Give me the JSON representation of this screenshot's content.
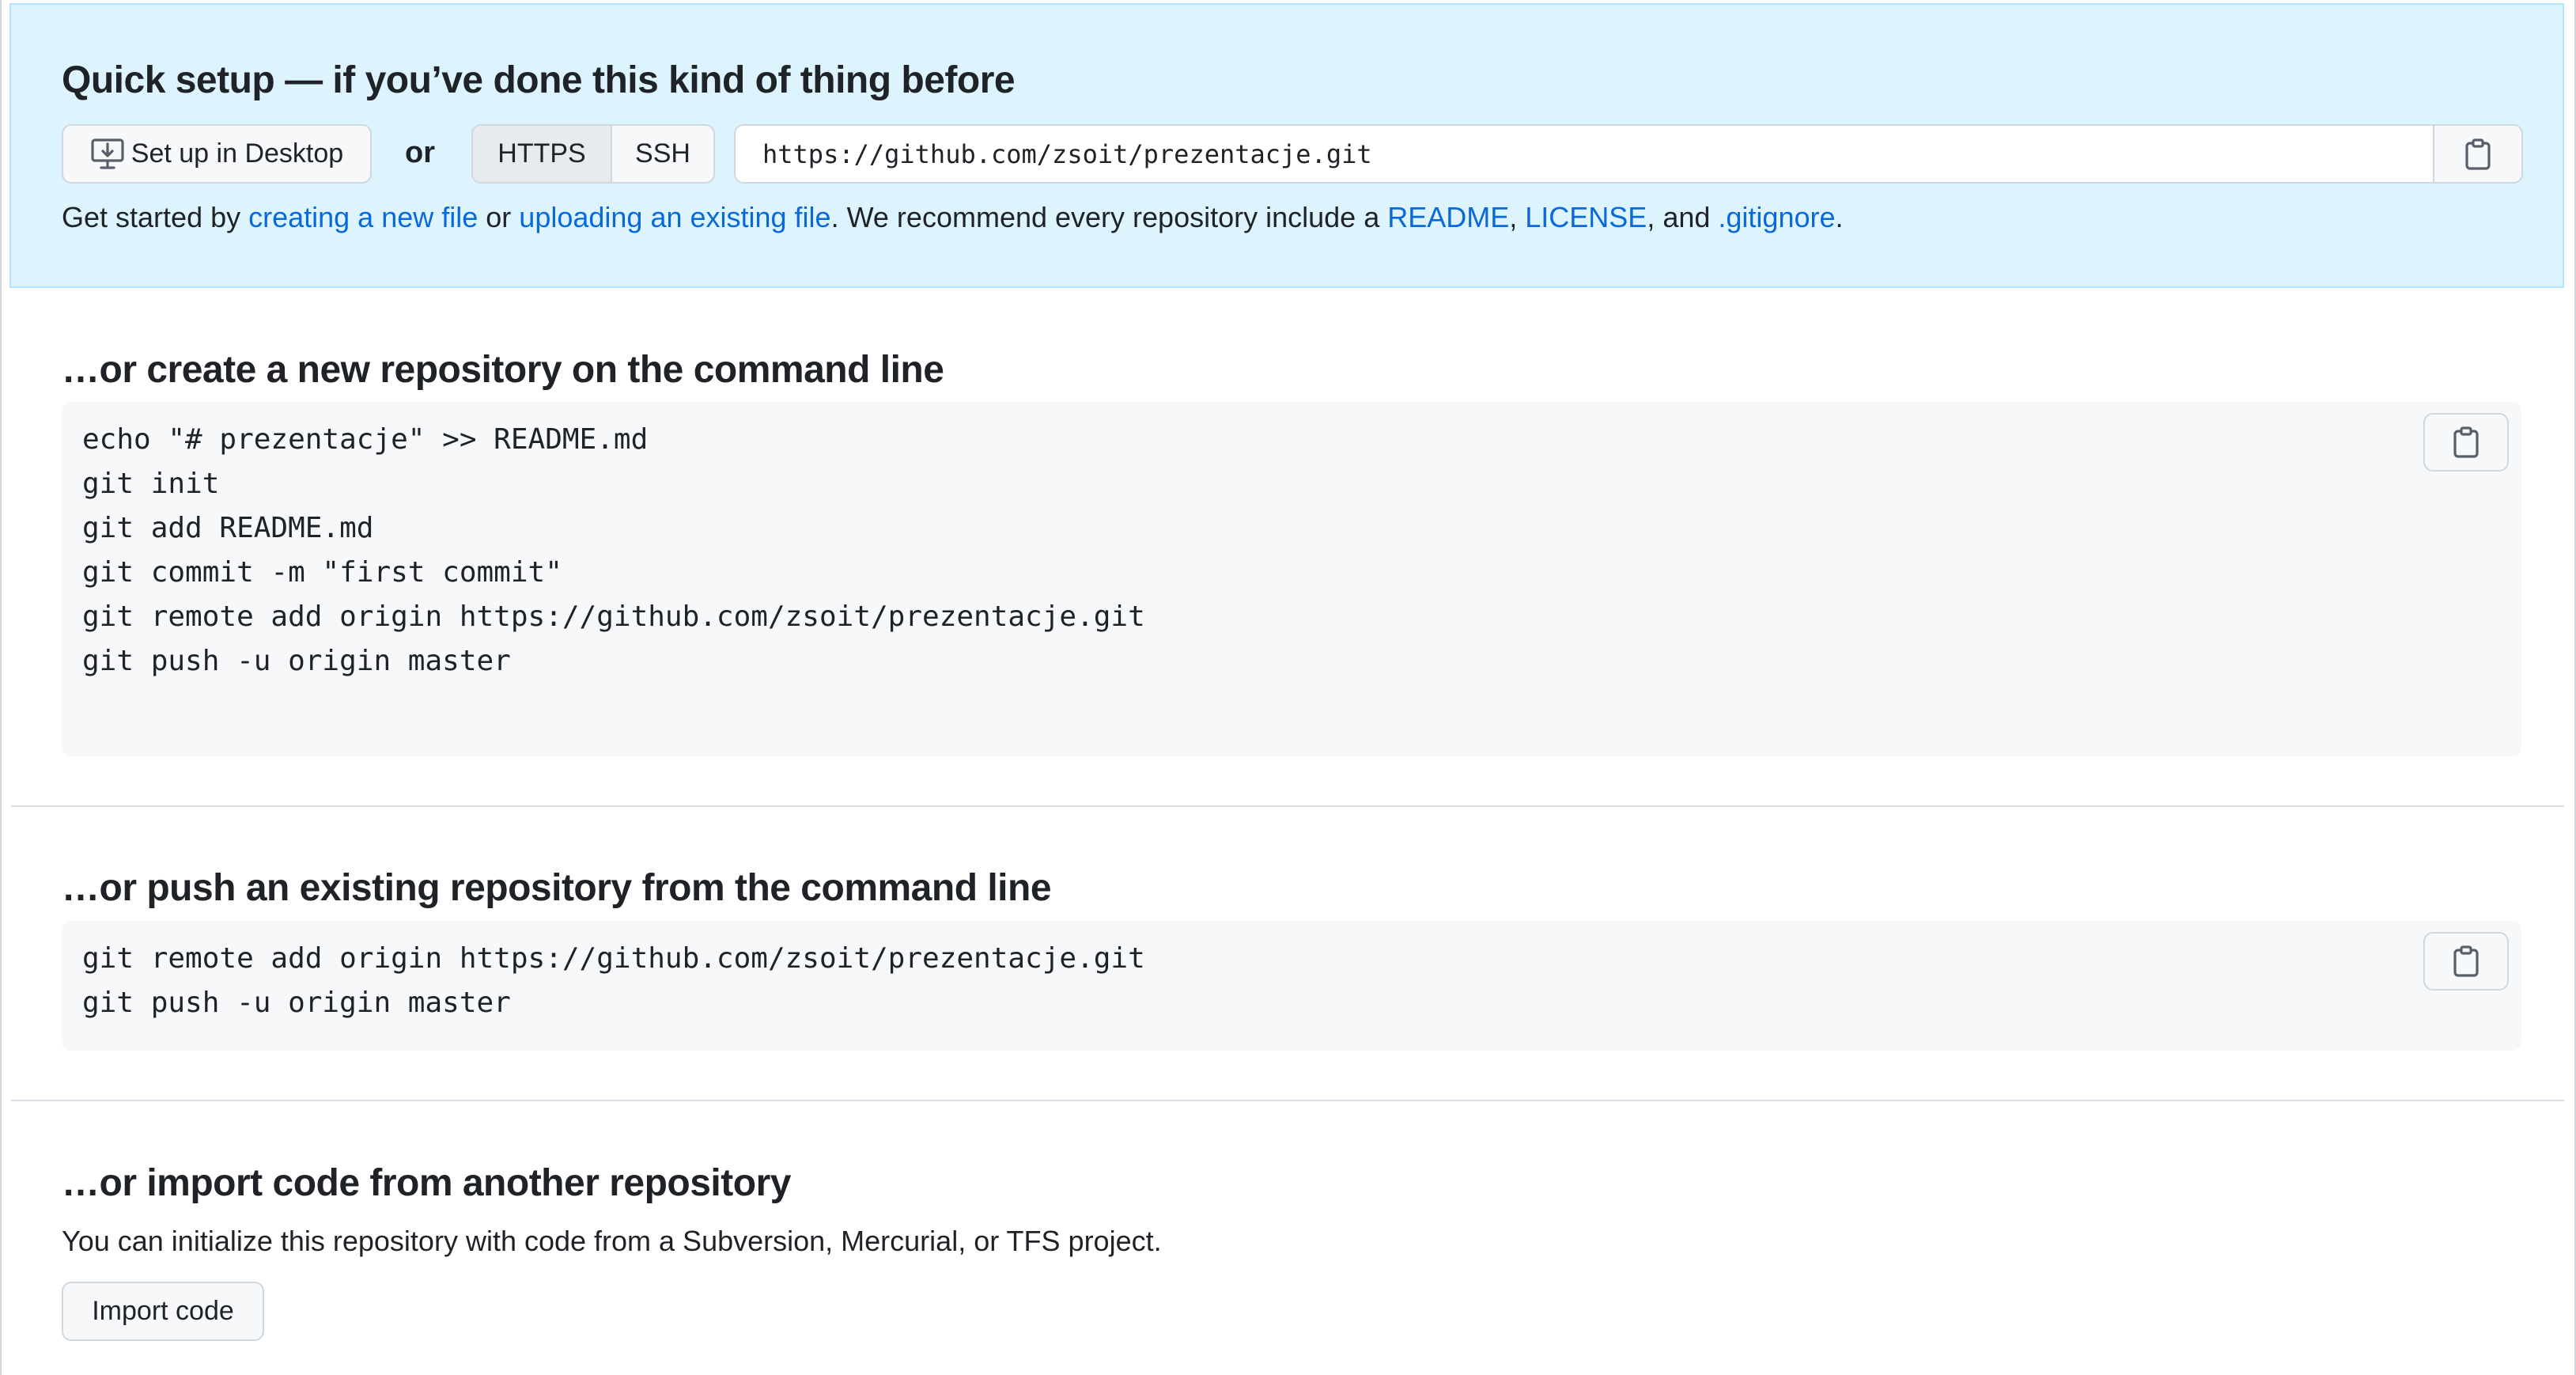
{
  "quick_setup": {
    "title": "Quick setup — if you’ve done this kind of thing before",
    "desktop_button_label": "Set up in Desktop",
    "or_label": "or",
    "protocol_tabs": [
      "HTTPS",
      "SSH"
    ],
    "selected_protocol": "HTTPS",
    "clone_url": "https://github.com/zsoit/prezentacje.git",
    "get_started": {
      "prefix": "Get started by ",
      "link_new_file": "creating a new file",
      "or": " or ",
      "link_upload": "uploading an existing file",
      "middle": ". We recommend every repository include a ",
      "link_readme": "README",
      "comma": ", ",
      "link_license": "LICENSE",
      "and": ", and ",
      "link_gitignore": ".gitignore",
      "end": "."
    }
  },
  "create_section": {
    "title": "…or create a new repository on the command line",
    "lines": [
      "echo \"# prezentacje\" >> README.md",
      "git init",
      "git add README.md",
      "git commit -m \"first commit\"",
      "git remote add origin https://github.com/zsoit/prezentacje.git",
      "git push -u origin master"
    ]
  },
  "push_section": {
    "title": "…or push an existing repository from the command line",
    "lines": [
      "git remote add origin https://github.com/zsoit/prezentacje.git",
      "git push -u origin master"
    ]
  },
  "import_section": {
    "title": "…or import code from another repository",
    "description": "You can initialize this repository with code from a Subversion, Mercurial, or TFS project.",
    "button_label": "Import code"
  },
  "icons": {
    "desktop": "desktop-download-icon",
    "copy": "clipboard-copy-icon"
  },
  "colors": {
    "link": "#0969da",
    "quick_setup_bg": "#ddf4ff",
    "code_bg": "#f6f8fa"
  }
}
